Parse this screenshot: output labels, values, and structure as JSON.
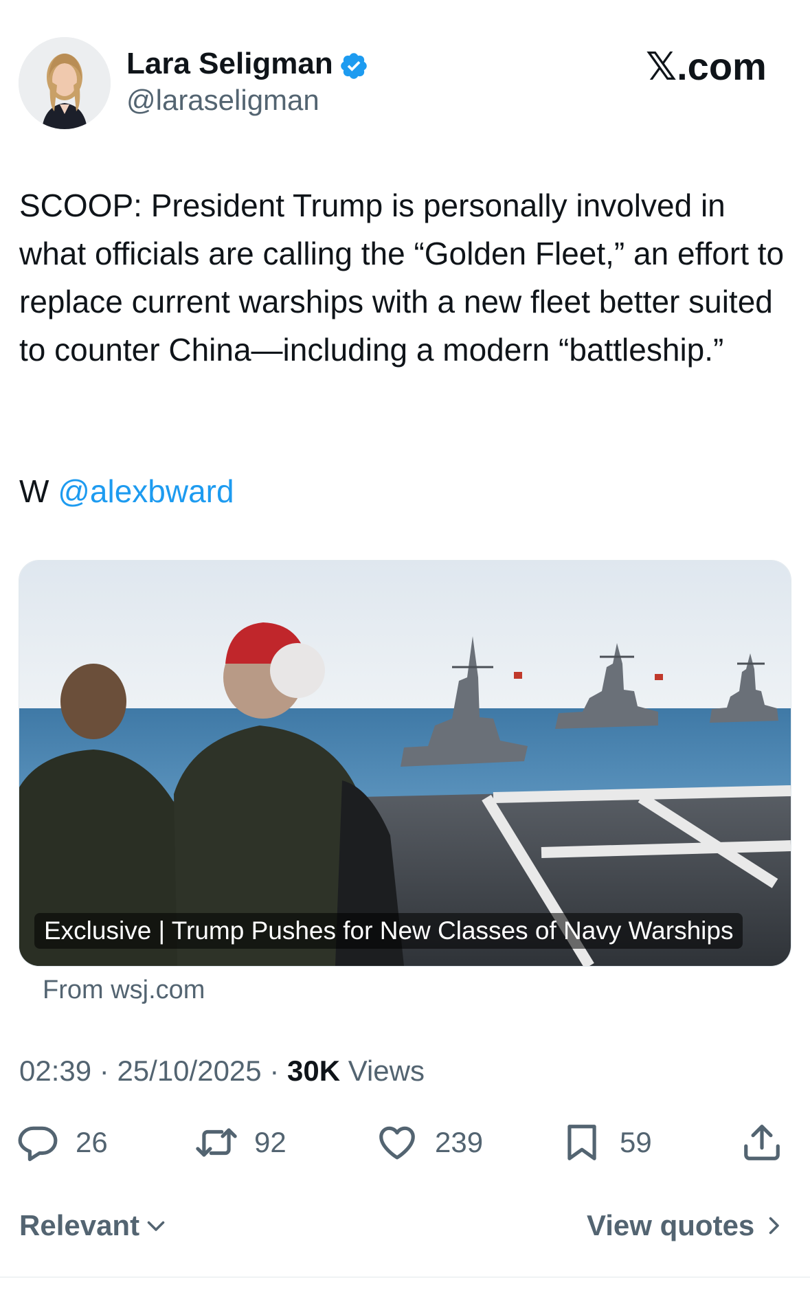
{
  "author": {
    "name": "Lara Seligman",
    "handle": "@laraseligman",
    "verified": true
  },
  "brand": {
    "logo_text": ".com",
    "logo_glyph": "𝕏"
  },
  "tweet": {
    "text": "SCOOP: President Trump is personally involved in what officials are calling the “Golden Fleet,” an effort to replace current warships with a new fleet better suited to counter China—including a modern “battleship.”",
    "w_prefix": "W",
    "mention": "@alexbward"
  },
  "card": {
    "caption": "Exclusive | Trump Pushes for New Classes of Navy Warships",
    "source": "From wsj.com"
  },
  "meta": {
    "time": "02:39",
    "date": "25/10/2025",
    "views_count": "30K",
    "views_label": "Views"
  },
  "actions": {
    "replies": "26",
    "reposts": "92",
    "likes": "239",
    "bookmarks": "59"
  },
  "footer": {
    "sort_label": "Relevant",
    "quotes_label": "View quotes"
  },
  "colors": {
    "link": "#1d9bf0",
    "verified": "#1d9bf0",
    "secondary_text": "#536471",
    "primary_text": "#0f1419"
  }
}
